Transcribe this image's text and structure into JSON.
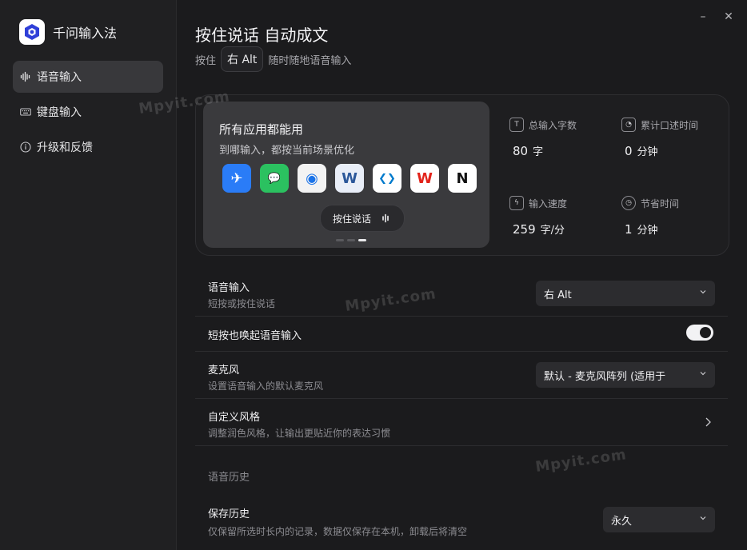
{
  "app": {
    "name": "千问输入法"
  },
  "sidebar": {
    "items": [
      {
        "label": "语音输入",
        "icon": "waveform-icon",
        "active": true
      },
      {
        "label": "键盘输入",
        "icon": "keyboard-icon",
        "active": false
      },
      {
        "label": "升级和反馈",
        "icon": "info-icon",
        "active": false
      }
    ]
  },
  "window": {
    "minimize": "–",
    "close": "✕"
  },
  "header": {
    "title": "按住说话 自动成文",
    "sub_prefix": "按住",
    "key": "右 Alt",
    "sub_suffix": "随时随地语音输入"
  },
  "hero": {
    "title": "所有应用都能用",
    "subtitle": "到哪输入，都按当前场景优化",
    "apps": [
      {
        "name": "feishu-icon",
        "bg": "#2a7cf7",
        "glyph": "✈",
        "fg": "#ffffff"
      },
      {
        "name": "wechat-icon",
        "bg": "#2bc160",
        "glyph": "💬",
        "fg": "#ffffff"
      },
      {
        "name": "chrome-icon",
        "bg": "#f3f3f3",
        "glyph": "◉",
        "fg": "#1a73e8"
      },
      {
        "name": "word-icon",
        "bg": "#e9eef8",
        "glyph": "W",
        "fg": "#2b579a"
      },
      {
        "name": "vscode-icon",
        "bg": "#ffffff",
        "glyph": "❮❯",
        "fg": "#007acc"
      },
      {
        "name": "wps-icon",
        "bg": "#ffffff",
        "glyph": "W",
        "fg": "#e2231a"
      },
      {
        "name": "notion-icon",
        "bg": "#ffffff",
        "glyph": "N",
        "fg": "#111111"
      }
    ],
    "ptt_label": "按住说话"
  },
  "stats": [
    {
      "label": "总输入字数",
      "icon": "text-t-icon",
      "value": "80",
      "unit": "字"
    },
    {
      "label": "累计口述时间",
      "icon": "speaking-person-icon",
      "value": "0",
      "unit": "分钟"
    },
    {
      "label": "输入速度",
      "icon": "lightning-icon",
      "value": "259",
      "unit": "字/分"
    },
    {
      "label": "节省时间",
      "icon": "clock-icon",
      "value": "1",
      "unit": "分钟"
    }
  ],
  "settings": {
    "voice": {
      "title": "语音输入",
      "desc": "短按或按住说话",
      "value": "右 Alt"
    },
    "short_press": {
      "title": "短按也唤起语音输入",
      "enabled": true
    },
    "mic": {
      "title": "麦克风",
      "desc": "设置语音输入的默认麦克风",
      "value": "默认 - 麦克风阵列 (适用于"
    },
    "style": {
      "title": "自定义风格",
      "desc": "调整润色风格，让输出更贴近你的表达习惯"
    },
    "history_section": "语音历史",
    "history": {
      "title": "保存历史",
      "desc": "仅保留所选时长内的记录，数据仅保存在本机，卸载后将清空",
      "value": "永久"
    }
  },
  "watermark": "Mpyit.com",
  "colors": {
    "bg": "#1b1b1d",
    "sidebar": "#202022",
    "panel": "#3a3a3d",
    "accent": "#2f3fd8"
  }
}
